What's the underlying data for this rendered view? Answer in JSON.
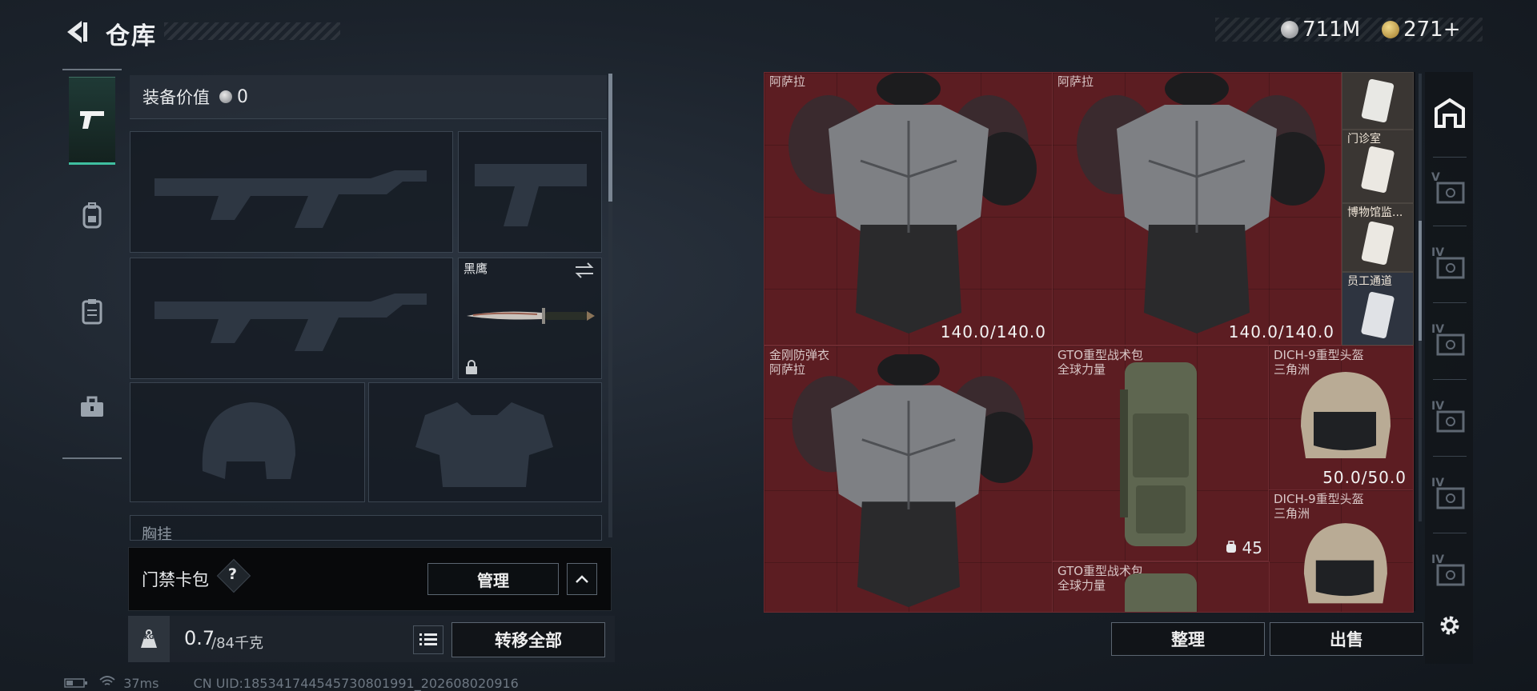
{
  "header": {
    "title": "仓库",
    "silver_amount": "711M",
    "gold_amount": "271+"
  },
  "left_tabs": [
    {
      "name": "weapons",
      "icon": "pistol-icon"
    },
    {
      "name": "backpack",
      "icon": "backpack-icon"
    },
    {
      "name": "vest",
      "icon": "clipboard-icon"
    },
    {
      "name": "toolbox",
      "icon": "toolbox-icon"
    }
  ],
  "loadout": {
    "value_label": "装备价值",
    "value_amount": "0",
    "knife_slot_name": "黑鹰",
    "chest_rig_label": "胸挂",
    "card_pack_label": "门禁卡包",
    "help_symbol": "?",
    "manage_label": "管理",
    "weight_current": "0.7",
    "weight_max": "/84千克",
    "weight_icon_text": "KG",
    "transfer_all_label": "转移全部"
  },
  "inventory": {
    "items": [
      {
        "name": "阿萨拉",
        "durability": "140.0/140.0"
      },
      {
        "name": "阿萨拉",
        "durability": "140.0/140.0"
      },
      {
        "name": "金刚防弹衣\n阿萨拉",
        "durability": ""
      },
      {
        "name": "GTO重型战术包\n全球力量",
        "capacity": "45"
      },
      {
        "name": "DICH-9重型头盔\n三角洲",
        "durability": "50.0/50.0"
      },
      {
        "name": "DICH-9重型头盔\n三角洲",
        "durability": ""
      },
      {
        "name": "GTO重型战术包\n全球力量",
        "durability": ""
      }
    ],
    "keycards": [
      {
        "name": ""
      },
      {
        "name": "门诊室"
      },
      {
        "name": "博物馆监..."
      },
      {
        "name": "员工通道"
      }
    ],
    "sort_label": "整理",
    "sell_label": "出售"
  },
  "right_rail": {
    "tiers": [
      "V",
      "IV",
      "IV",
      "IV",
      "IV",
      "IV"
    ]
  },
  "status_bar": {
    "ping": "37ms",
    "uid": "CN UID:185341744545730801991_202608020916"
  },
  "colors": {
    "accent": "#3fbfa0",
    "item_bg": "#5c1d22",
    "panel": "#14181d"
  }
}
